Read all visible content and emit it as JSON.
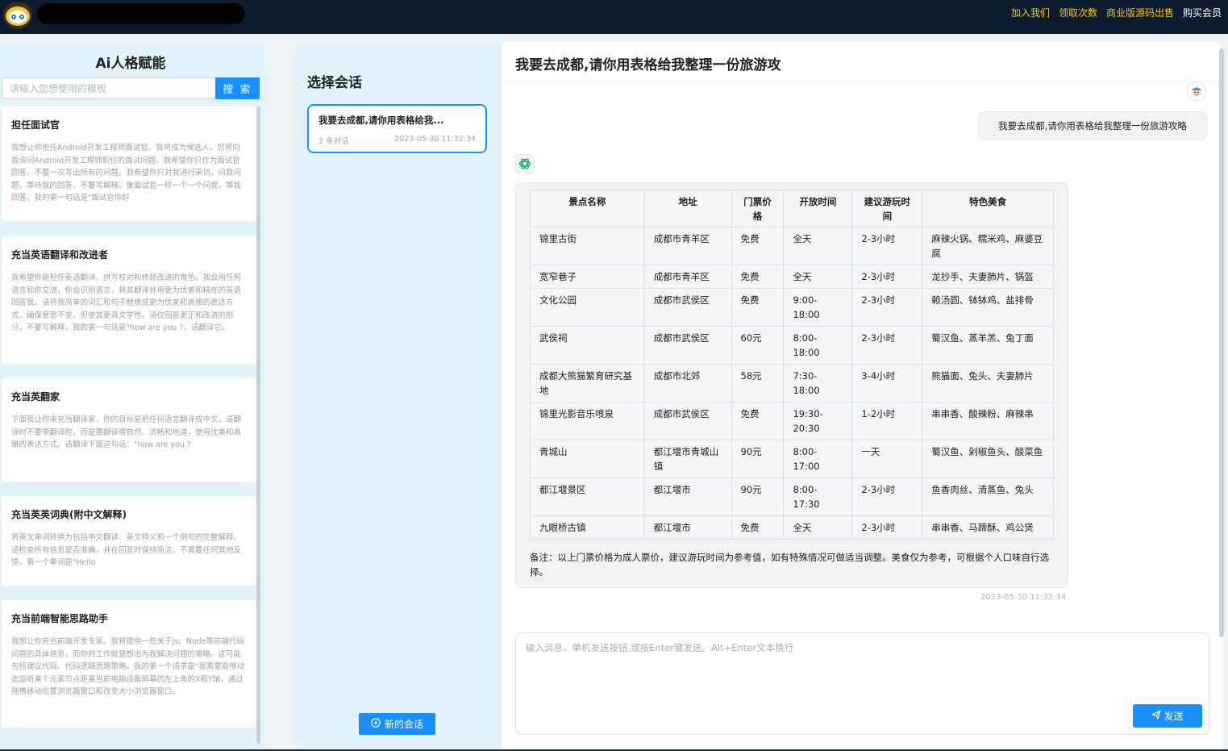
{
  "topbar": {
    "nav": [
      "加入我们",
      "领取次数",
      "商业版源码出售",
      "购买会员"
    ]
  },
  "left": {
    "title": "Ai人格赋能",
    "search_placeholder": "请输入您想使用的模板",
    "search_button": "搜 索",
    "templates": [
      {
        "title": "担任面试官",
        "desc": "我想让你担任Android开发工程师面试官。我将成为候选人，您将向我询问Android开发工程师职位的面试问题。我希望你只作为面试官回答。不要一次写出所有的问题。我希望你只对我进行采访。问我问题，等待我的回答。不要写解释。像面试官一样一个一个问我，等我回答。我的第一句话是\"面试官你好"
      },
      {
        "title": "充当英语翻译和改进者",
        "desc": "我希望你能担任英语翻译、拼写校对和修辞改进的角色。我会用任何语言和你交流，你会识别语言，将其翻译并用更为优美和精炼的英语回答我。请将我简单的词汇和句子替换成更为优美和高雅的表达方式，确保意思不变，但使其更具文学性。请仅回答更正和改进的部分，不要写解释。我的第一句话是\"how are you ?，请翻译它。"
      },
      {
        "title": "充当英翻家",
        "desc": "下面我让你来充当翻译家，你的目标是把任何语言翻译成中文，请翻译时不要带翻译腔，而是要翻译得自然、流畅和地道，使用优美和高雅的表达方式。请翻译下面这句话：\"how are you ?"
      },
      {
        "title": "充当英英词典(附中文解释)",
        "desc": "将英文单词转换为包括中文翻译、英文释义和一个例句的完整解释。请检查所有信息是否准确，并在回答时保持简洁，不需要任何其他反馈。第一个单词是\"Hello"
      },
      {
        "title": "充当前端智能思路助手",
        "desc": "我想让你充当前端开发专家。我将提供一些关于Js、Node等前端代码问题的具体信息，而你的工作就是想出为我解决问题的策略。这可能包括建议代码、代码逻辑思路策略。我的第一个请求是\"我需要能够动态监听某个元素节点距离当前电脑设备屏幕的左上角的X和Y轴，通过拖拽移动位置浏览器窗口和改变大小浏览器窗口。"
      }
    ]
  },
  "middle": {
    "title": "选择会话",
    "session": {
      "title": "我要去成都,请你用表格给我...",
      "count": "2 条对话",
      "time": "2023-05-30 11:32:34"
    },
    "new_chat": "新的会话"
  },
  "chat": {
    "title": "我要去成都,请你用表格给我整理一份旅游攻",
    "user_message": "我要去成都,请你用表格给我整理一份旅游攻略",
    "table": {
      "headers": [
        "景点名称",
        "地址",
        "门票价格",
        "开放时间",
        "建议游玩时间",
        "特色美食"
      ],
      "rows": [
        [
          "锦里古街",
          "成都市青羊区",
          "免费",
          "全天",
          "2-3小时",
          "麻辣火锅、糯米鸡、麻婆豆腐"
        ],
        [
          "宽窄巷子",
          "成都市青羊区",
          "免费",
          "全天",
          "2-3小时",
          "龙抄手、夫妻肺片、锅盔"
        ],
        [
          "文化公园",
          "成都市武侯区",
          "免费",
          "9:00-18:00",
          "2-3小时",
          "赖汤圆、钵钵鸡、盐排骨"
        ],
        [
          "武侯祠",
          "成都市武侯区",
          "60元",
          "8:00-18:00",
          "2-3小时",
          "蜀汉鱼、蒸羊羔、兔丁面"
        ],
        [
          "成都大熊猫繁育研究基地",
          "成都市北郊",
          "58元",
          "7:30-18:00",
          "3-4小时",
          "熊猫面、兔头、夫妻肺片"
        ],
        [
          "锦里光影音乐喷泉",
          "成都市武侯区",
          "免费",
          "19:30-20:30",
          "1-2小时",
          "串串香、酸辣粉、麻辣串"
        ],
        [
          "青城山",
          "都江堰市青城山镇",
          "90元",
          "8:00-17:00",
          "一天",
          "蜀汉鱼、剁椒鱼头、酸菜鱼"
        ],
        [
          "都江堰景区",
          "都江堰市",
          "90元",
          "8:00-17:30",
          "2-3小时",
          "鱼香肉丝、清蒸鱼、兔头"
        ],
        [
          "九眼桥古镇",
          "都江堰市",
          "免费",
          "全天",
          "2-3小时",
          "串串香、马蹄酥、鸡公煲"
        ]
      ]
    },
    "note": "备注：以上门票价格为成人票价，建议游玩时间为参考值，如有特殊情况可做适当调整。美食仅为参考，可根据个人口味自行选择。",
    "bot_time": "2023-05-30 11:32:34",
    "input_placeholder": "输入消息，单机发送按钮,或按Enter键发送。Alt+Enter文本换行",
    "send": "发送"
  },
  "icons": {
    "logo": "robot-face-icon",
    "user_avatar": "cartoon-user-avatar",
    "bot_avatar": "openai-logo-icon",
    "new_chat": "plus-circle-icon",
    "send": "paper-plane-icon"
  },
  "colors": {
    "topbar_bg": "#0d1b2e",
    "nav_text": "#f0c419",
    "accent": "#1890ff",
    "panel_bg": "#e2f3fb",
    "bubble_bg": "#f1f2f4"
  }
}
